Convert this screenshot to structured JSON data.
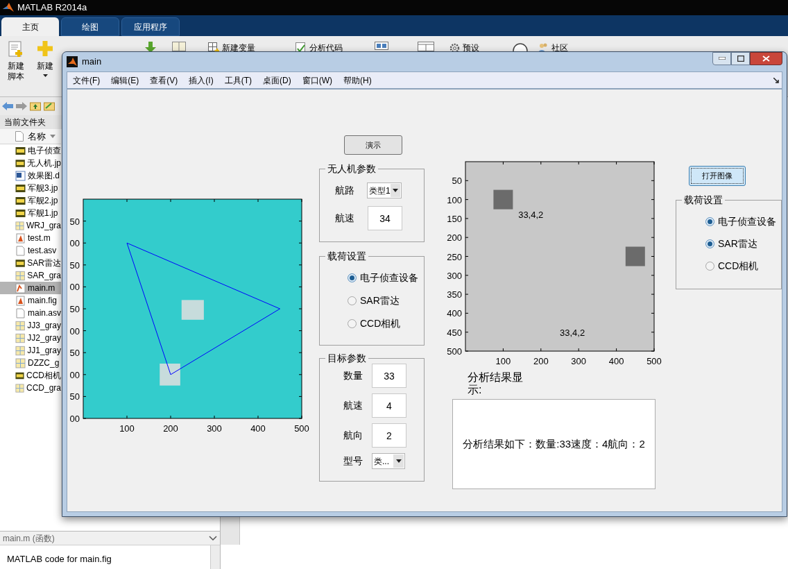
{
  "app": {
    "title": "MATLAB R2014a"
  },
  "ribbon_tabs": [
    {
      "label": "主页",
      "selected": true
    },
    {
      "label": "绘图",
      "selected": false
    },
    {
      "label": "应用程序",
      "selected": false
    }
  ],
  "toolstrip": {
    "new_script": [
      "新建",
      "脚本"
    ],
    "new": "新建",
    "new_variable": "新建变量",
    "analyze_code": "分析代码",
    "preferences": "预设",
    "community": "社区"
  },
  "current_folder": {
    "title": "当前文件夹",
    "column": "名称",
    "files": [
      {
        "name": "电子侦查",
        "kind": "jpg",
        "selected": false
      },
      {
        "name": "无人机.jp",
        "kind": "jpg",
        "selected": false
      },
      {
        "name": "效果图.d",
        "kind": "doc",
        "selected": false
      },
      {
        "name": "军舰3.jp",
        "kind": "jpg",
        "selected": false
      },
      {
        "name": "军舰2.jp",
        "kind": "jpg",
        "selected": false
      },
      {
        "name": "军舰1.jp",
        "kind": "jpg",
        "selected": false
      },
      {
        "name": "WRJ_gra",
        "kind": "mat",
        "selected": false
      },
      {
        "name": "test.m",
        "kind": "script",
        "selected": false
      },
      {
        "name": "test.asv",
        "kind": "text",
        "selected": false
      },
      {
        "name": "SAR雷达",
        "kind": "jpg",
        "selected": false
      },
      {
        "name": "SAR_gra",
        "kind": "mat",
        "selected": false
      },
      {
        "name": "main.m",
        "kind": "function",
        "selected": true
      },
      {
        "name": "main.fig",
        "kind": "script",
        "selected": false
      },
      {
        "name": "main.asv",
        "kind": "text",
        "selected": false
      },
      {
        "name": "JJ3_gray",
        "kind": "mat",
        "selected": false
      },
      {
        "name": "JJ2_gray",
        "kind": "mat",
        "selected": false
      },
      {
        "name": "JJ1_gray",
        "kind": "mat",
        "selected": false
      },
      {
        "name": "DZZC_g",
        "kind": "mat",
        "selected": false
      },
      {
        "name": "CCD相机",
        "kind": "jpg",
        "selected": false
      },
      {
        "name": "CCD_gra",
        "kind": "mat",
        "selected": false
      }
    ]
  },
  "details": {
    "title": "main.m (函数)",
    "text": "MATLAB code for main.fig"
  },
  "figure": {
    "title": "main",
    "menu": [
      "文件(F)",
      "编辑(E)",
      "查看(V)",
      "插入(I)",
      "工具(T)",
      "桌面(D)",
      "窗口(W)",
      "帮助(H)"
    ],
    "left_axes": {
      "x_tick_labels": [
        "100",
        "200",
        "300",
        "400",
        "500"
      ],
      "y_tick_labels": [
        "50",
        "00",
        "50",
        "00",
        "50",
        "00",
        "50",
        "00",
        "50",
        "00"
      ]
    },
    "demo_button": "演示",
    "uav_params": {
      "title": "无人机参数",
      "route_label": "航路",
      "route_value": "类型1",
      "speed_label": "航速",
      "speed_value": "34"
    },
    "payload": {
      "title": "载荷设置",
      "options": [
        {
          "label": "电子侦查设备",
          "selected": true
        },
        {
          "label": "SAR雷达",
          "selected": false
        },
        {
          "label": "CCD相机",
          "selected": false
        }
      ]
    },
    "target_params": {
      "title": "目标参数",
      "fields": [
        {
          "label": "数量",
          "value": "33",
          "kind": "field"
        },
        {
          "label": "航速",
          "value": "4",
          "kind": "field"
        },
        {
          "label": "航向",
          "value": "2",
          "kind": "field"
        },
        {
          "label": "型号",
          "value": "类...",
          "kind": "dropdown"
        }
      ]
    },
    "right_axes": {
      "chart_data": {
        "type": "scatter",
        "xlim": [
          0,
          500
        ],
        "ylim": [
          500,
          0
        ],
        "xticks": [
          100,
          200,
          300,
          400,
          500
        ],
        "yticks": [
          50,
          100,
          150,
          200,
          250,
          300,
          350,
          400,
          450,
          500
        ],
        "x": [
          100,
          450
        ],
        "series": [
          {
            "values": [
              100,
              250
            ]
          }
        ],
        "annotations": [
          "33,4,2",
          "33,4,2"
        ]
      }
    },
    "result_label": "分析结果显示:",
    "result_text": "分析结果如下：数量:33速度：4航向：2",
    "open_image_button": "打开图像",
    "payload_right": {
      "title": "载荷设置",
      "options": [
        {
          "label": "电子侦查设备",
          "selected": true
        },
        {
          "label": "SAR雷达",
          "selected": true
        },
        {
          "label": "CCD相机",
          "selected": false
        }
      ]
    }
  }
}
